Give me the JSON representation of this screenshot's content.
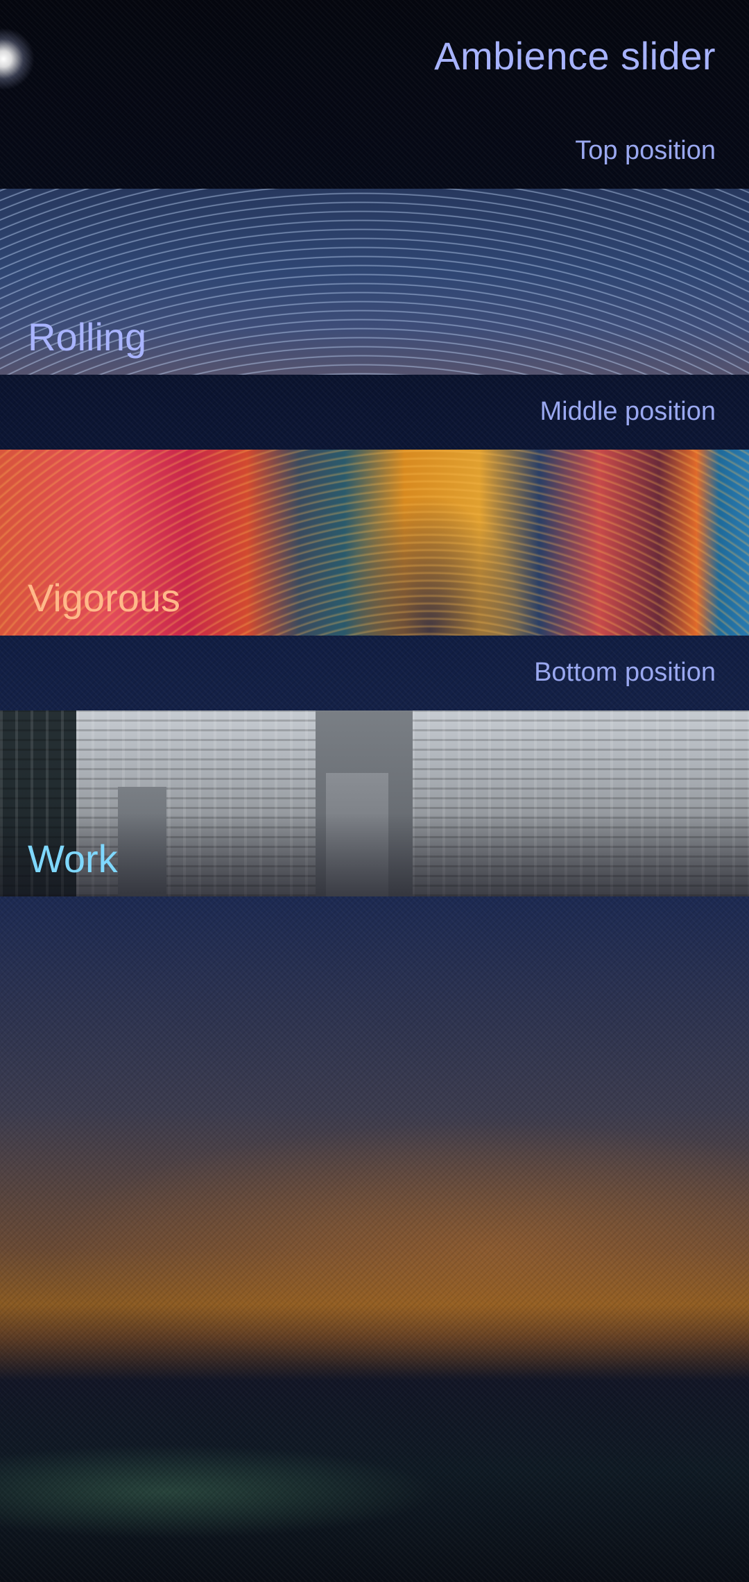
{
  "header": {
    "title": "Ambience slider"
  },
  "sections": [
    {
      "position_label": "Top position",
      "ambience_name": "Rolling"
    },
    {
      "position_label": "Middle position",
      "ambience_name": "Vigorous"
    },
    {
      "position_label": "Bottom position",
      "ambience_name": "Work"
    }
  ],
  "colors": {
    "title": "#a7b3ff",
    "rolling_label": "#a9b4ff",
    "vigorous_label": "#ffb98a",
    "work_label": "#7fd8ff"
  }
}
